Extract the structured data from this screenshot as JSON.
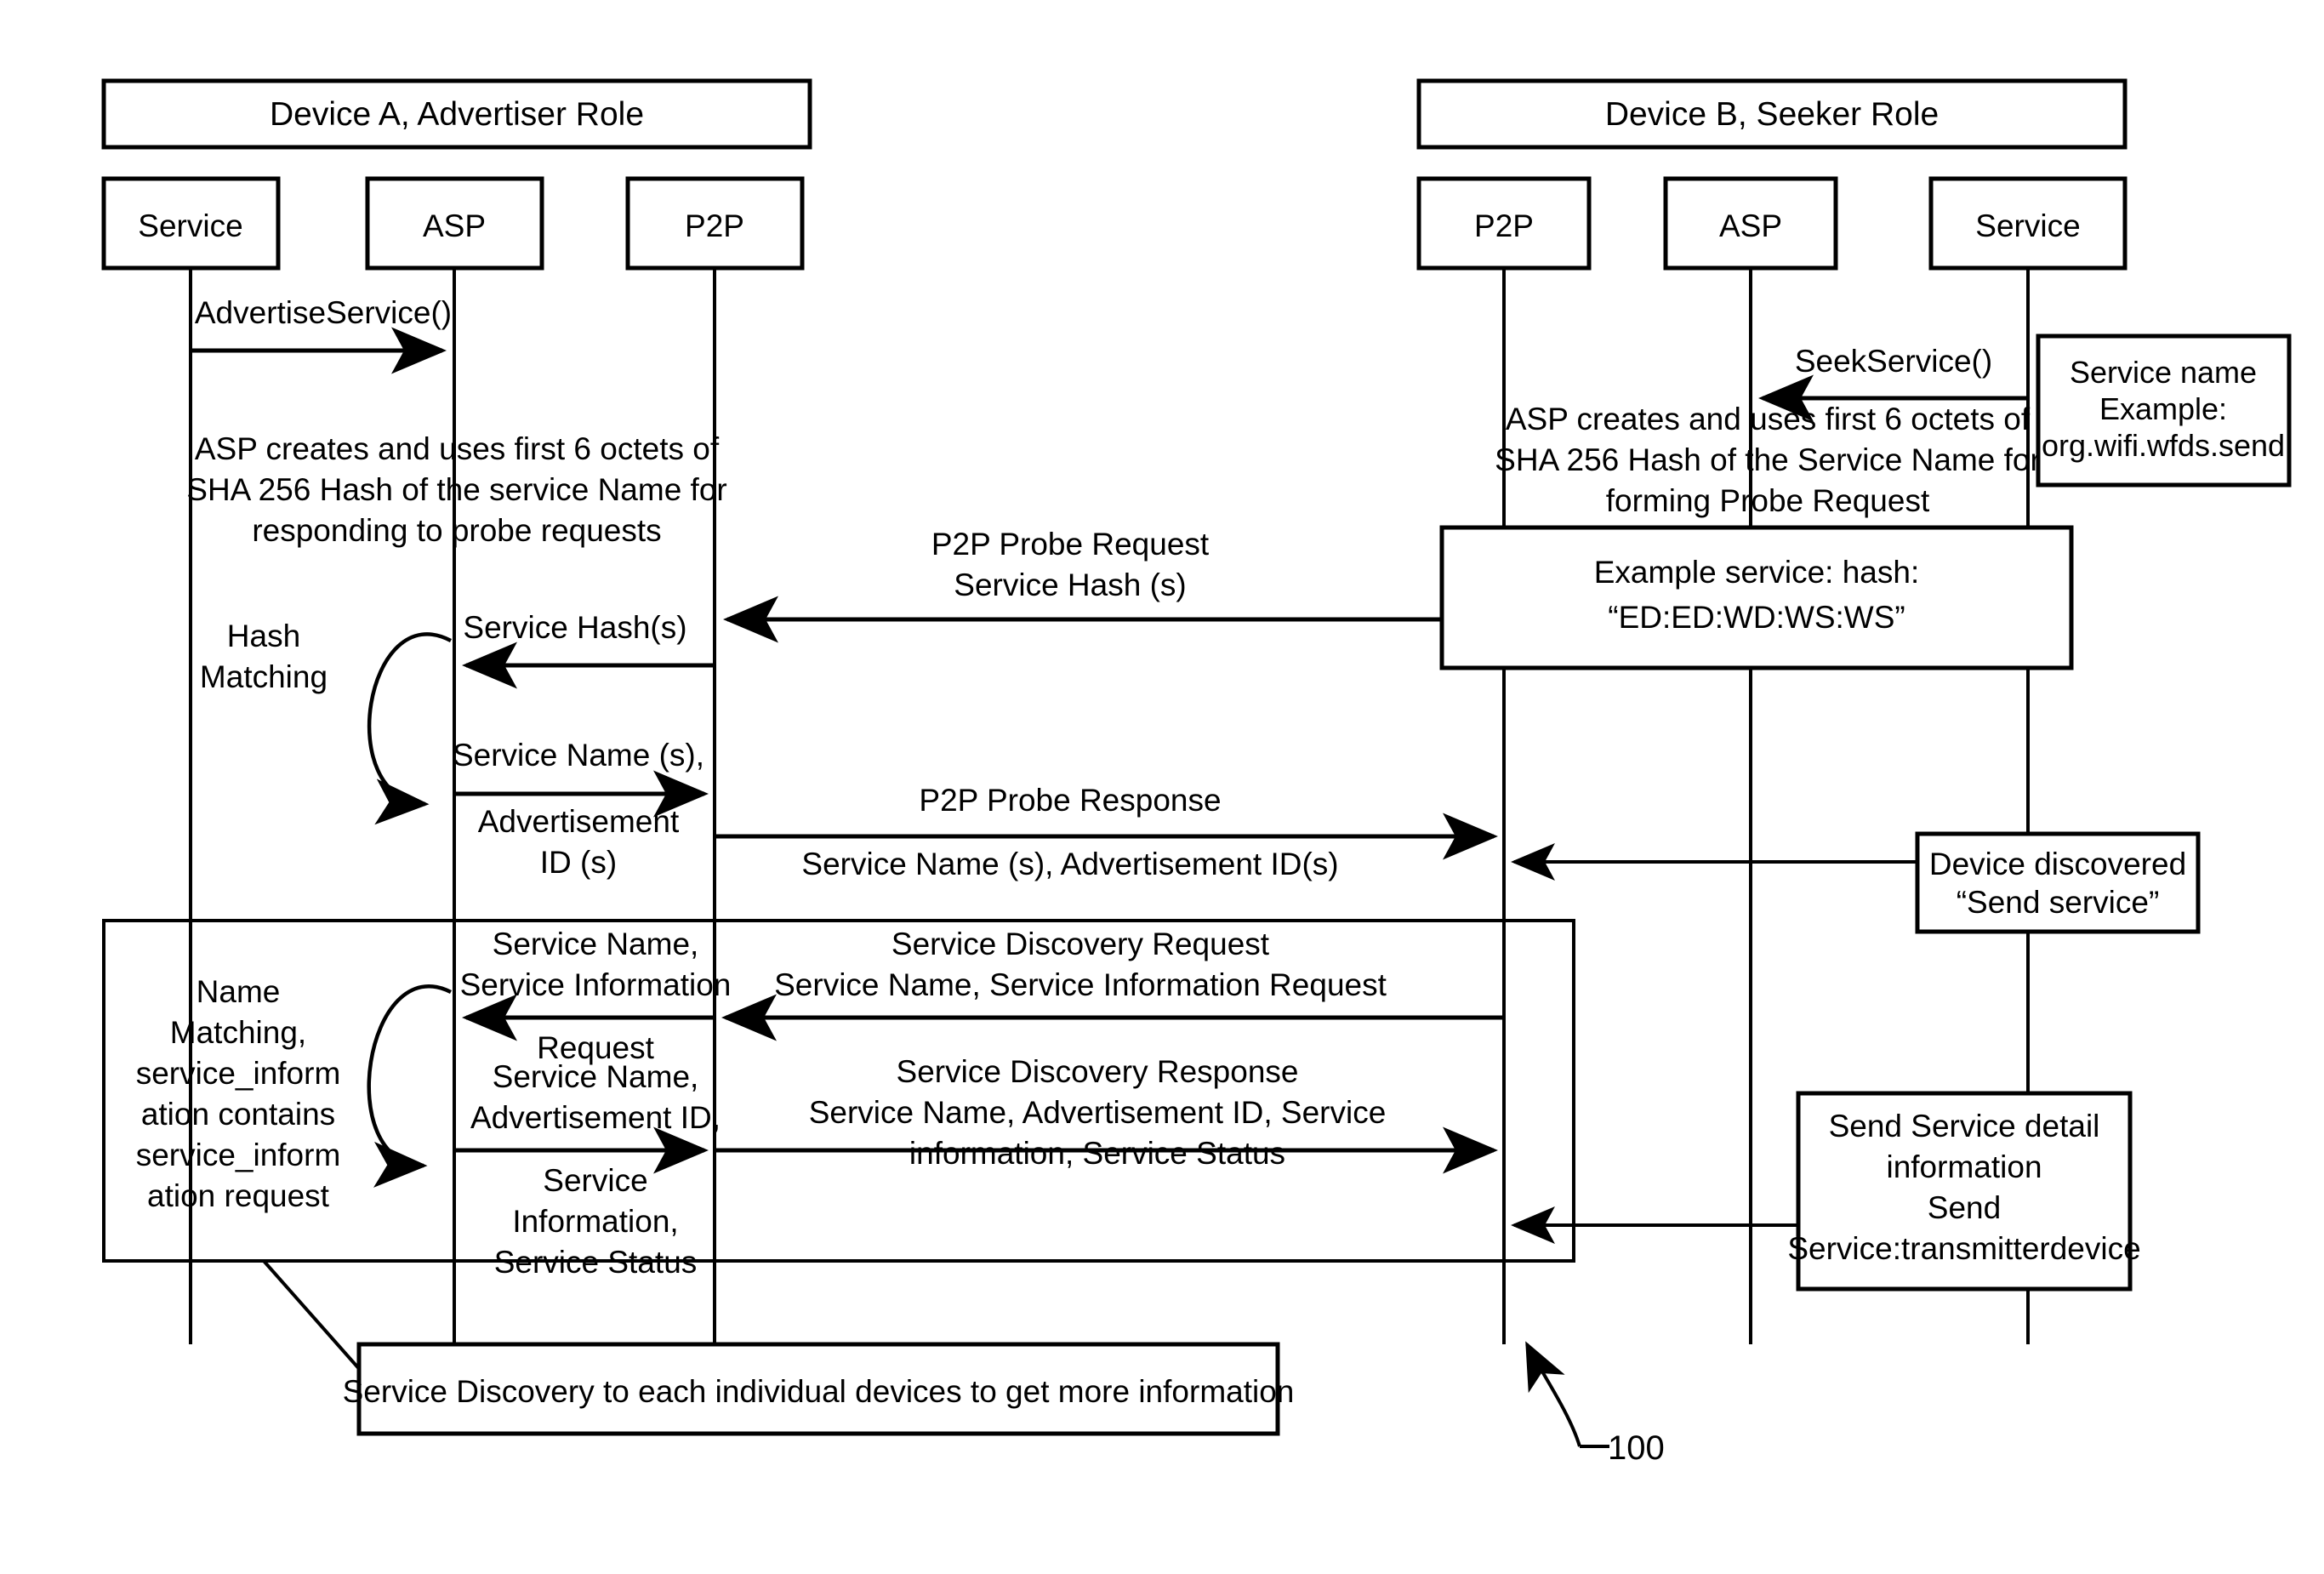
{
  "figure": {
    "reference_numeral": "100",
    "type": "sequence-diagram"
  },
  "devices": [
    {
      "id": "device-a",
      "title": "Device A, Advertiser Role"
    },
    {
      "id": "device-b",
      "title": "Device B, Seeker Role"
    }
  ],
  "lifelines": [
    {
      "id": "a-service",
      "label": "Service"
    },
    {
      "id": "a-asp",
      "label": "ASP"
    },
    {
      "id": "a-p2p",
      "label": "P2P"
    },
    {
      "id": "b-p2p",
      "label": "P2P"
    },
    {
      "id": "b-asp",
      "label": "ASP"
    },
    {
      "id": "b-service",
      "label": "Service"
    }
  ],
  "messages": {
    "advertise_service": "AdvertiseService()",
    "seek_service": "SeekService()",
    "service_hash_s": "Service Hash(s)",
    "service_name_s": "Service Name (s),",
    "advertisement_id_s": "Advertisement",
    "advertisement_id_s2": "ID (s)",
    "probe_request_l1": "P2P Probe Request",
    "probe_request_l2": "Service Hash (s)",
    "probe_response_l1": "P2P Probe Response",
    "probe_response_l2": "Service Name (s), Advertisement ID(s)",
    "sd_request_left_l1": "Service Name,",
    "sd_request_left_l2": "Service Information",
    "sd_request_left_l3": "Request",
    "sd_request_mid_l1": "Service Discovery Request",
    "sd_request_mid_l2": "Service Name, Service Information Request",
    "sd_response_left_l1": "Service Name,",
    "sd_response_left_l2": "Advertisement ID,",
    "sd_response_left_l3": "Service",
    "sd_response_left_l4": "Information,",
    "sd_response_left_l5": "Service Status",
    "sd_response_mid_l1": "Service Discovery Response",
    "sd_response_mid_l2": "Service Name, Advertisement ID, Service",
    "sd_response_mid_l3": "information, Service Status"
  },
  "notes": {
    "advertiser_hash_note": {
      "l1": "ASP creates and uses first 6 octets of",
      "l2": "SHA 256 Hash of the service Name for",
      "l3": "responding to probe requests"
    },
    "seeker_hash_note": {
      "l1": "ASP creates and uses first 6 octets of",
      "l2": "SHA 256 Hash of the Service Name for",
      "l3": "forming Probe Request"
    },
    "hash_matching": {
      "l1": "Hash",
      "l2": "Matching"
    },
    "name_matching": {
      "l1": "Name",
      "l2": "Matching,",
      "l3": "service_inform",
      "l4": "ation contains",
      "l5": "service_inform",
      "l6": "ation request"
    }
  },
  "boxes": {
    "service_name_example": {
      "l1": "Service name",
      "l2": "Example:",
      "l3": "org.wifi.wfds.send"
    },
    "example_hash": {
      "l1": "Example service: hash:",
      "l2": "“ED:ED:WD:WS:WS”"
    },
    "device_discovered": {
      "l1": "Device discovered",
      "l2": "“Send service”"
    },
    "send_service_detail": {
      "l1": "Send Service detail",
      "l2": "information",
      "l3": "Send",
      "l4": "Service:transmitterdevice"
    },
    "caption": {
      "text": "Service Discovery to each individual devices to get more information"
    }
  },
  "colors": {
    "stroke": "#000000",
    "background": "#ffffff",
    "text": "#000000"
  }
}
